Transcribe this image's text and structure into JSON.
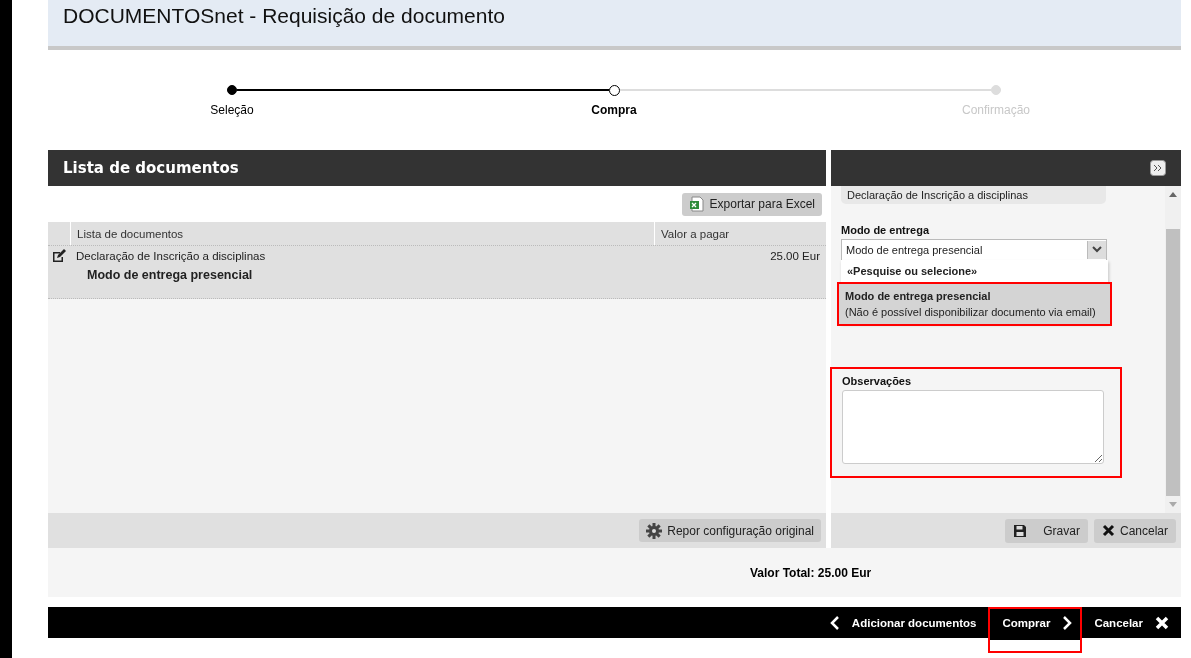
{
  "header": {
    "title": "DOCUMENTOSnet - Requisição de documento"
  },
  "steps": [
    {
      "label": "Seleção",
      "completed": true,
      "selected": false
    },
    {
      "label": "Compra",
      "completed": false,
      "selected": true
    },
    {
      "label": "Confirmação",
      "completed": false,
      "selected": false
    }
  ],
  "document_list": {
    "title": "Lista de documentos",
    "export_button": "Exportar para Excel",
    "columns": [
      "Lista de documentos",
      "Valor a pagar"
    ],
    "rows": [
      {
        "document": "Declaração de Inscrição a disciplinas",
        "amount": "25.00 Eur",
        "delivery": "Modo de entrega presencial"
      }
    ],
    "reset_button": "Repor configuração original"
  },
  "detail_panel": {
    "document": "Declaração de Inscrição a disciplinas",
    "delivery_label": "Modo de entrega",
    "delivery_value": "Modo de entrega presencial",
    "options": [
      {
        "title": "«Pesquise ou selecione»",
        "selected": false,
        "highlighted": false
      },
      {
        "title": "Modo de entrega presencial",
        "note": "(Não é possível disponibilizar documento via email)",
        "selected": true,
        "highlighted": true
      }
    ],
    "notes_label": "Observações",
    "notes_highlighted": true,
    "buttons": [
      {
        "kind": "save",
        "label": "Gravar"
      },
      {
        "kind": "cancel",
        "label": "Cancelar"
      }
    ]
  },
  "total": "Valor Total: 25.00 Eur",
  "footer": {
    "items": [
      {
        "kind": "back",
        "label": "Adicionar documentos",
        "highlighted": false
      },
      {
        "kind": "next",
        "label": "Comprar",
        "highlighted": true
      },
      {
        "kind": "cancel",
        "label": "Cancelar",
        "highlighted": false
      }
    ]
  }
}
